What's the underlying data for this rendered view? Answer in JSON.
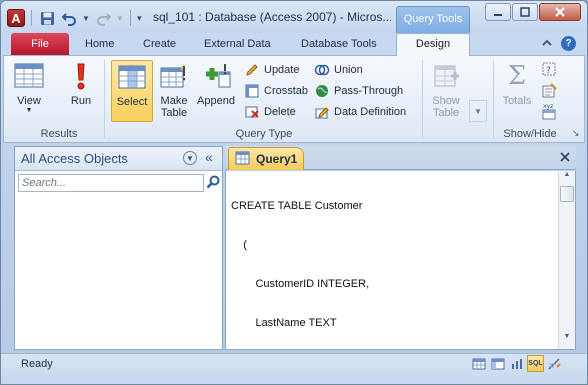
{
  "app": {
    "window_title": "sql_101 : Database (Access 2007) - Micros...",
    "contextual_tab_label": "Query Tools",
    "app_icon_letter": "A"
  },
  "ribbon_tabs": [
    "File",
    "Home",
    "Create",
    "External Data",
    "Database Tools",
    "Design"
  ],
  "ribbon_active_tab": "Design",
  "ribbon": {
    "results": {
      "label": "Results",
      "buttons": [
        "View",
        "Run"
      ]
    },
    "query_type": {
      "label": "Query Type",
      "select": "Select",
      "make_table": [
        "Make",
        "Table"
      ],
      "append": "Append",
      "small_buttons": [
        "Update",
        "Crosstab",
        "Delete",
        "Union",
        "Pass-Through",
        "Data Definition"
      ]
    },
    "query_setup": {
      "show_table": [
        "Show",
        "Table"
      ]
    },
    "show_hide": {
      "label": "Show/Hide",
      "totals": "Totals"
    }
  },
  "nav_pane": {
    "title": "All Access Objects",
    "search_placeholder": "Search..."
  },
  "document": {
    "tab_label": "Query1",
    "sql_lines": [
      "CREATE TABLE Customer",
      "    (",
      "        CustomerID INTEGER,",
      "        LastName TEXT",
      "    )"
    ]
  },
  "statusbar": {
    "text": "Ready",
    "view_buttons": [
      "datasheet-view-icon",
      "pivottable-view-icon",
      "pivotchart-view-icon",
      "SQL",
      "design-view-icon"
    ]
  },
  "colors": {
    "file_tab": "#c41e33",
    "selected_button": "#f8cf5c",
    "nav_title": "#2b4f83",
    "accent_blue": "#2f6cc4"
  }
}
